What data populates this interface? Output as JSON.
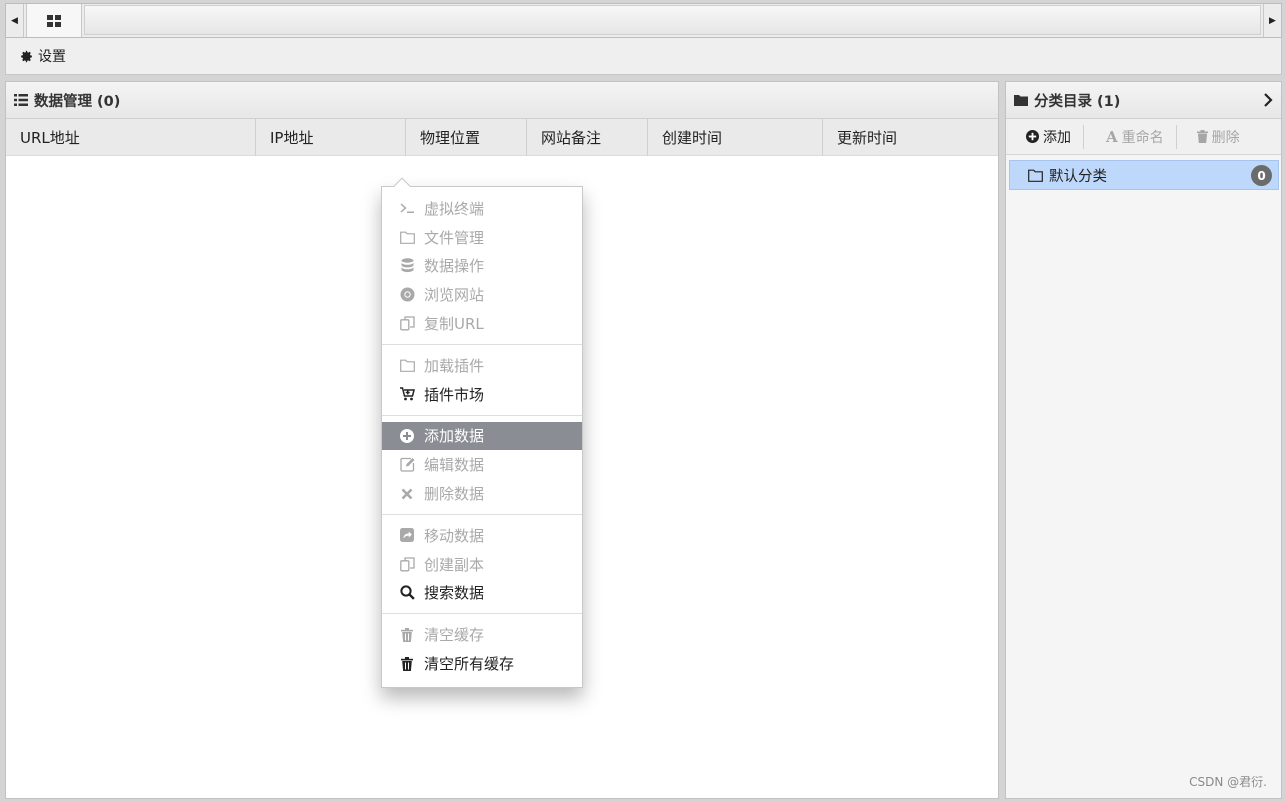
{
  "tabs": {
    "home_icon": "grid-icon",
    "scroll_left": "◀",
    "scroll_right": "▶"
  },
  "toolbar": {
    "settings_label": "设置",
    "settings_icon": "gear-icon"
  },
  "data_panel": {
    "title": "数据管理 (0)",
    "columns": [
      "URL地址",
      "IP地址",
      "物理位置",
      "网站备注",
      "创建时间",
      "更新时间"
    ]
  },
  "category_panel": {
    "title": "分类目录 (1)",
    "actions": {
      "add": "添加",
      "rename": "重命名",
      "delete": "删除"
    },
    "items": [
      {
        "label": "默认分类",
        "count": "0"
      }
    ]
  },
  "context_menu": {
    "groups": [
      [
        {
          "label": "虚拟终端",
          "icon": "terminal-icon",
          "state": "disabled"
        },
        {
          "label": "文件管理",
          "icon": "folder-icon",
          "state": "disabled"
        },
        {
          "label": "数据操作",
          "icon": "database-icon",
          "state": "disabled"
        },
        {
          "label": "浏览网站",
          "icon": "chrome-icon",
          "state": "disabled"
        },
        {
          "label": "复制URL",
          "icon": "copy-icon",
          "state": "disabled"
        }
      ],
      [
        {
          "label": "加载插件",
          "icon": "folder-icon",
          "state": "disabled"
        },
        {
          "label": "插件市场",
          "icon": "cart-icon",
          "state": "enabled"
        }
      ],
      [
        {
          "label": "添加数据",
          "icon": "plus-circle-icon",
          "state": "active"
        },
        {
          "label": "编辑数据",
          "icon": "edit-icon",
          "state": "disabled"
        },
        {
          "label": "删除数据",
          "icon": "close-icon",
          "state": "disabled"
        }
      ],
      [
        {
          "label": "移动数据",
          "icon": "share-icon",
          "state": "disabled"
        },
        {
          "label": "创建副本",
          "icon": "copy-icon",
          "state": "disabled"
        },
        {
          "label": "搜索数据",
          "icon": "search-icon",
          "state": "enabled"
        }
      ],
      [
        {
          "label": "清空缓存",
          "icon": "trash-icon",
          "state": "disabled"
        },
        {
          "label": "清空所有缓存",
          "icon": "trash-icon",
          "state": "enabled"
        }
      ]
    ]
  },
  "watermark": "CSDN @君衍.",
  "colors": {
    "selection": "#bed8fb",
    "menu_active": "#8a8d93",
    "disabled_text": "#a9a9a9"
  }
}
